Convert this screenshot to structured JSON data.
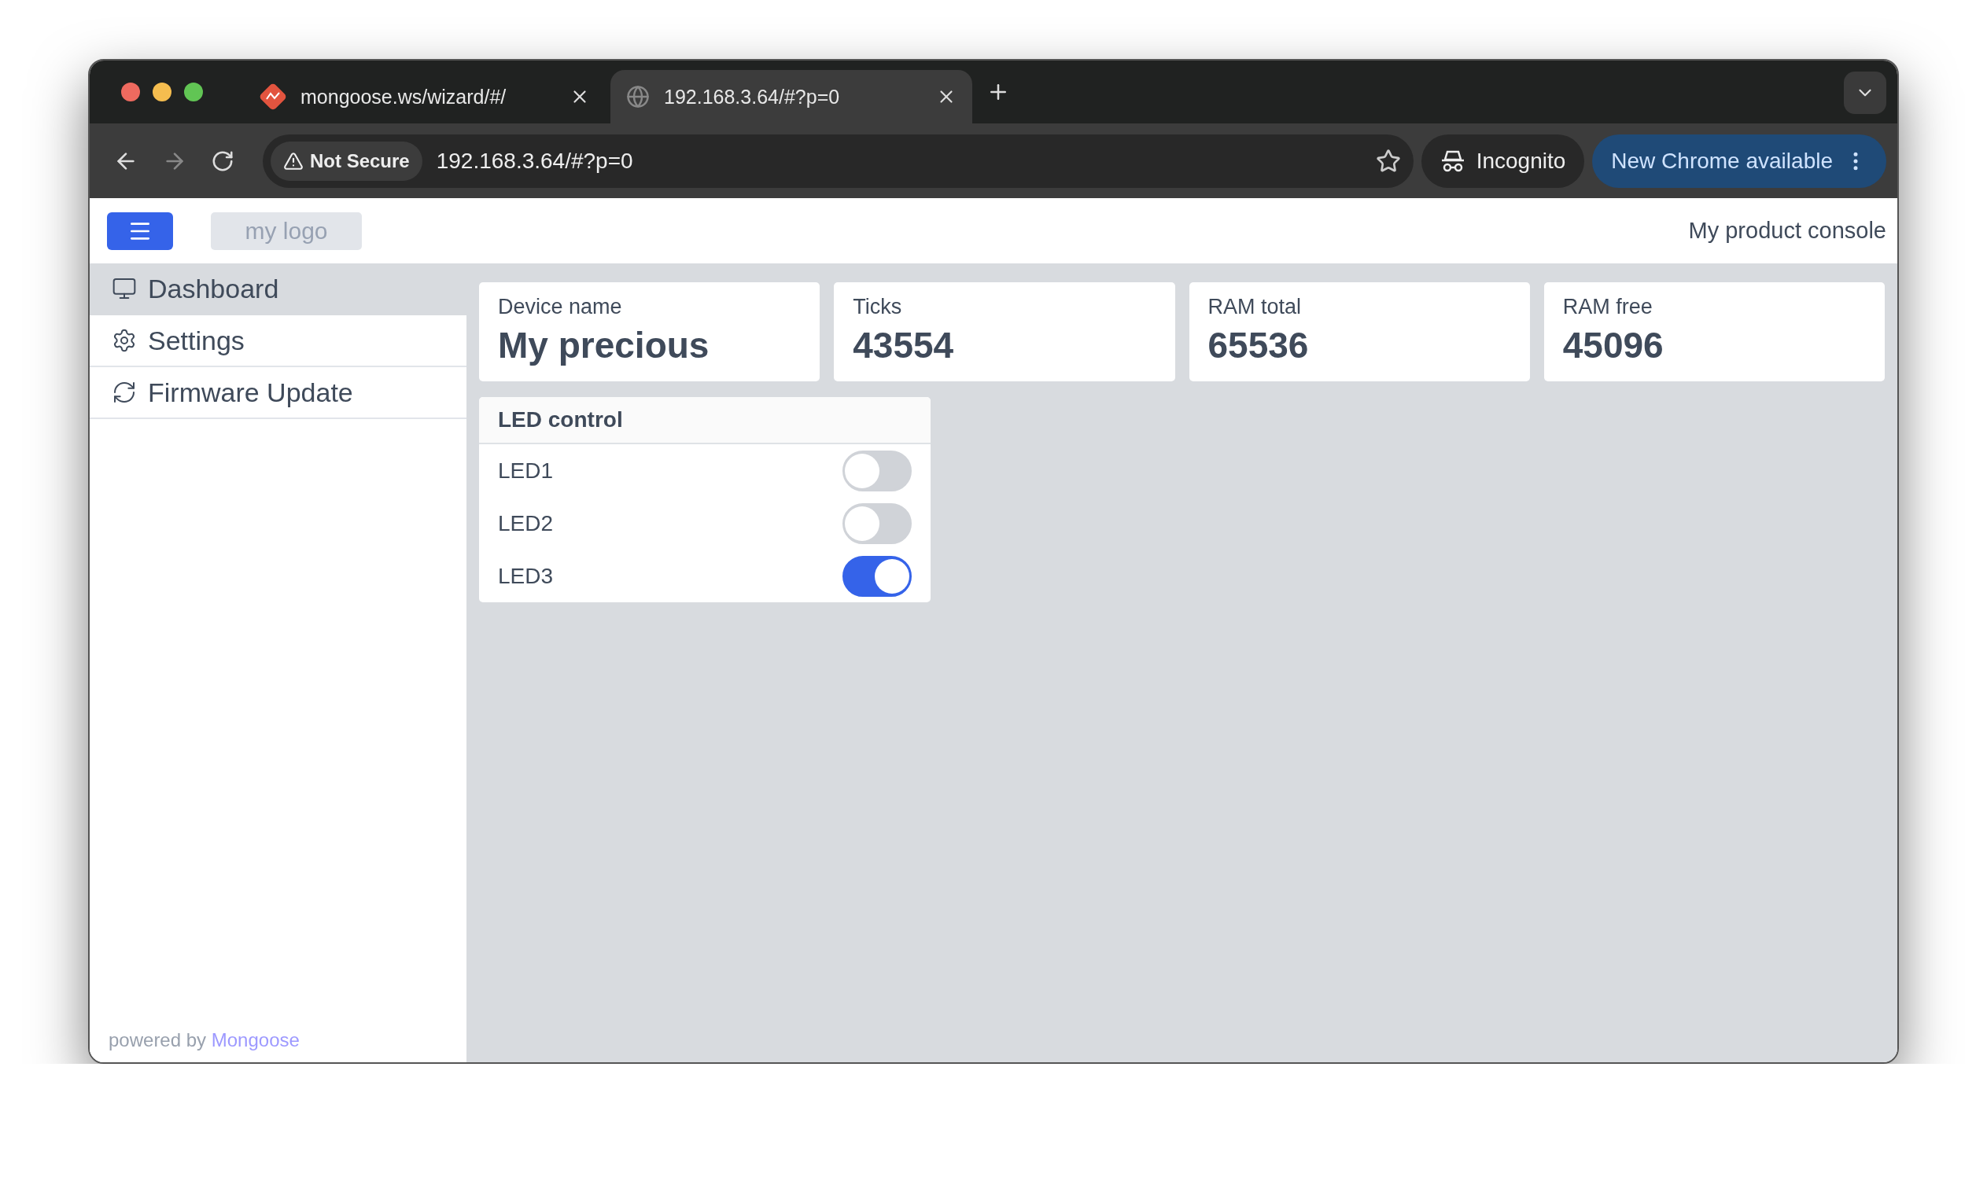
{
  "browser": {
    "tabs": [
      {
        "title": "mongoose.ws/wizard/#/",
        "selected": false
      },
      {
        "title": "192.168.3.64/#?p=0",
        "selected": true
      }
    ],
    "security": "Not Secure",
    "url": "192.168.3.64/#?p=0",
    "profile": "Incognito",
    "update": "New Chrome available"
  },
  "header": {
    "logo": "my logo",
    "title": "My product console"
  },
  "sidebar": {
    "items": [
      {
        "label": "Dashboard",
        "selected": true
      },
      {
        "label": "Settings",
        "selected": false
      },
      {
        "label": "Firmware Update",
        "selected": false
      }
    ],
    "footer": {
      "text": "powered by",
      "link": "Mongoose"
    }
  },
  "stats": [
    {
      "label": "Device name",
      "value": "My precious"
    },
    {
      "label": "Ticks",
      "value": "43554"
    },
    {
      "label": "RAM total",
      "value": "65536"
    },
    {
      "label": "RAM free",
      "value": "45096"
    }
  ],
  "led_panel": {
    "title": "LED control",
    "leds": [
      {
        "label": "LED1",
        "on": false
      },
      {
        "label": "LED2",
        "on": false
      },
      {
        "label": "LED3",
        "on": true
      }
    ]
  }
}
